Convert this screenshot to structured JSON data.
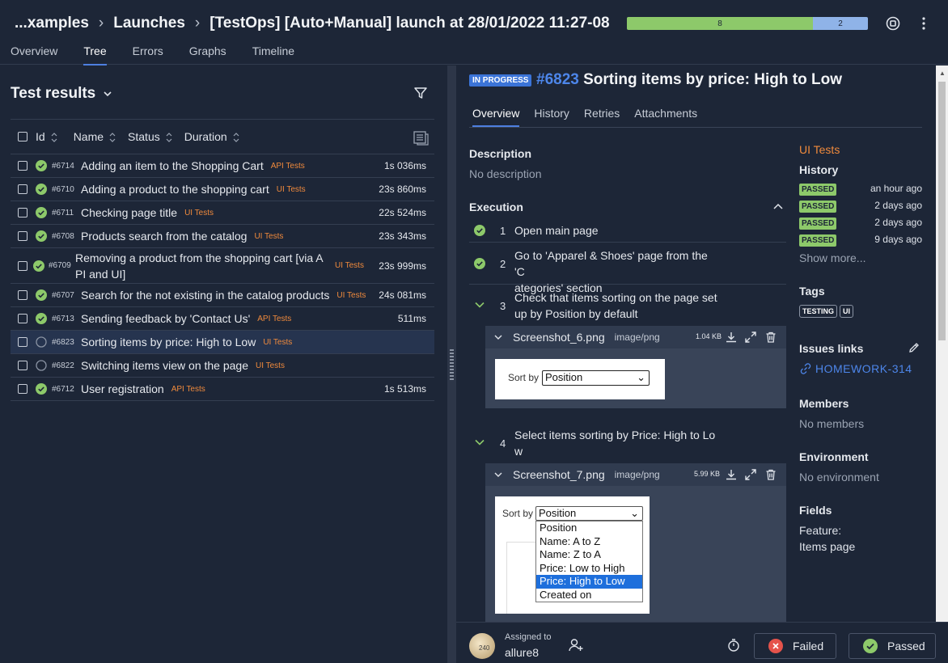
{
  "header": {
    "breadcrumb": [
      "...xamples",
      "Launches",
      "[TestOps] [Auto+Manual] launch at 28/01/2022 11:27-08"
    ],
    "progress": {
      "passed": 8,
      "unknown": 2,
      "colors": {
        "passed": "#8dc96a",
        "unknown": "#8fb3e8"
      }
    },
    "tabs": [
      "Overview",
      "Tree",
      "Errors",
      "Graphs",
      "Timeline"
    ],
    "active_tab": "Tree"
  },
  "left": {
    "title": "Test results",
    "columns": {
      "id": "Id",
      "name": "Name",
      "status": "Status",
      "duration": "Duration"
    },
    "rows": [
      {
        "id": "#6714",
        "name": "Adding an item to the Shopping Cart",
        "tag": "API Tests",
        "duration": "1s 036ms",
        "status": "passed"
      },
      {
        "id": "#6710",
        "name": "Adding a product to the shopping cart",
        "tag": "UI Tests",
        "duration": "23s 860ms",
        "status": "passed"
      },
      {
        "id": "#6711",
        "name": "Checking page title",
        "tag": "UI Tests",
        "duration": "22s 524ms",
        "status": "passed"
      },
      {
        "id": "#6708",
        "name": "Products search from the catalog",
        "tag": "UI Tests",
        "duration": "23s 343ms",
        "status": "passed"
      },
      {
        "id": "#6709",
        "name": "Removing a product from the shopping cart [via A",
        "name2": "PI and UI]",
        "tag": "UI Tests",
        "duration": "23s 999ms",
        "status": "passed"
      },
      {
        "id": "#6707",
        "name": "Search for the not existing in the catalog products",
        "tag": "UI Tests",
        "duration": "24s 081ms",
        "status": "passed"
      },
      {
        "id": "#6713",
        "name": "Sending feedback by 'Contact Us'",
        "tag": "API Tests",
        "duration": "511ms",
        "status": "passed"
      },
      {
        "id": "#6823",
        "name": "Sorting items by price: High to Low",
        "tag": "UI Tests",
        "duration": "",
        "status": "in-progress"
      },
      {
        "id": "#6822",
        "name": "Switching items view on the page",
        "tag": "UI Tests",
        "duration": "",
        "status": "in-progress"
      },
      {
        "id": "#6712",
        "name": "User registration",
        "tag": "API Tests",
        "duration": "1s 513ms",
        "status": "passed"
      }
    ]
  },
  "case": {
    "status_badge": "IN PROGRESS",
    "number": "#6823",
    "title": "Sorting items by price: High to Low",
    "tabs": [
      "Overview",
      "History",
      "Retries",
      "Attachments"
    ],
    "description_label": "Description",
    "description": "No description",
    "execution_label": "Execution",
    "steps": [
      {
        "num": "1",
        "text": "Open main page",
        "state": "passed"
      },
      {
        "num": "2",
        "text": "Go to  'Apparel & Shoes' page from the 'C",
        "text2": "ategories' section",
        "state": "passed"
      },
      {
        "num": "3",
        "text": "Check that items sorting on the page set",
        "text2": "up by Position by default",
        "state": "expanded"
      },
      {
        "num": "4",
        "text": "Select items sorting by Price: High to Lo",
        "text2": "w",
        "state": "expanded"
      }
    ],
    "attachments": [
      {
        "file": "Screenshot_6.png",
        "mime": "image/png",
        "size": "1.04 KB",
        "sort_label": "Sort by",
        "sort_value": "Position"
      },
      {
        "file": "Screenshot_7.png",
        "mime": "image/png",
        "size": "5.99 KB",
        "sort_label": "Sort by",
        "sort_value": "Position",
        "options": [
          "Position",
          "Name: A to Z",
          "Name: Z to A",
          "Price: Low to High",
          "Price: High to Low",
          "Created on"
        ],
        "highlighted": "Price: High to Low"
      }
    ]
  },
  "sidebar": {
    "suite": "UI Tests",
    "history_label": "History",
    "history": [
      {
        "status": "PASSED",
        "when": "an hour ago"
      },
      {
        "status": "PASSED",
        "when": "2 days ago"
      },
      {
        "status": "PASSED",
        "when": "2 days ago"
      },
      {
        "status": "PASSED",
        "when": "9 days ago"
      }
    ],
    "show_more": "Show more...",
    "tags_label": "Tags",
    "tags": [
      "TESTING",
      "UI"
    ],
    "issues_label": "Issues links",
    "issue": "HOMEWORK-314",
    "members_label": "Members",
    "members": "No members",
    "env_label": "Environment",
    "env": "No environment",
    "fields_label": "Fields",
    "field_name": "Feature:",
    "field_value": "Items page"
  },
  "footer": {
    "assigned_label": "Assigned to",
    "assigned_user": "allure8",
    "avatar_text": "240",
    "failed_label": "Failed",
    "passed_label": "Passed"
  },
  "colors": {
    "accent": "#4d86ea",
    "tag": "#f08a3c",
    "passed": "#8dc96a",
    "failed": "#e5534b"
  }
}
